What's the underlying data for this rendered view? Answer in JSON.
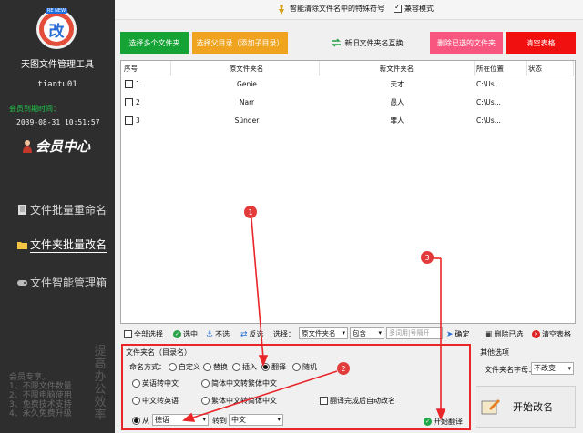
{
  "sidebar": {
    "logo_badge": "RE NEW",
    "logo_char": "改",
    "app_title": "天图文件管理工具",
    "user": "tiantu01",
    "expire_label": "会员到期时间：",
    "expire_date": "2039-08-31 10:51:57",
    "member_center": "会员中心",
    "nav": [
      "文件批量重命名",
      "文件夹批量改名",
      "文件智能管理箱"
    ],
    "vip_lines": [
      "会员专享。",
      "1、不限文件数量",
      "2、不限电脑使用",
      "3、免费技术支持",
      "4、永久免费升级"
    ],
    "ad": "提高办公效率"
  },
  "topbar": {
    "special_chars": "智能清除文件名中的特殊符号",
    "compat_mode": "兼容模式"
  },
  "toolbar": {
    "add_multi": "选择多个文件夹",
    "add_sub": "选择父目录（添加子目录）",
    "swap": "新旧文件夹名互换",
    "delete_selected": "删除已选的文件夹",
    "clear_table": "清空表格"
  },
  "table": {
    "headers": [
      "序号",
      "原文件夹名",
      "新文件夹名",
      "所在位置",
      "状态"
    ],
    "rows": [
      {
        "no": "1",
        "orig": "Genie",
        "new": "天才",
        "loc": "C:\\Us...",
        "status": ""
      },
      {
        "no": "2",
        "orig": "Narr",
        "new": "愚人",
        "loc": "C:\\Us...",
        "status": ""
      },
      {
        "no": "3",
        "orig": "Sünder",
        "new": "罪人",
        "loc": "C:\\Us...",
        "status": ""
      }
    ]
  },
  "selbar": {
    "select_all": "全部选择",
    "check": "选中",
    "uncheck": "不选",
    "invert": "反选",
    "select_label": "选择：",
    "field": "原文件夹名",
    "match": "包含",
    "placeholder": "多词用|号隔开",
    "confirm": "确定",
    "delete_sel": "删除已选",
    "clear": "清空表格"
  },
  "panel": {
    "title": "文件夹名（目录名）",
    "mode_label": "命名方式：",
    "modes": [
      "自定义",
      "替换",
      "插入",
      "翻译",
      "随机"
    ],
    "options": [
      "英语转中文",
      "简体中文转繁体中文",
      "中文转英语",
      "繁体中文转简体中文"
    ],
    "auto_rename": "翻译完成后自动改名",
    "from_label": "从",
    "from_lang": "德语",
    "to_label": "转到",
    "to_lang": "中文",
    "start_translate": "开始翻译"
  },
  "other": {
    "title": "其他选项",
    "case_label": "文件夹名字母：",
    "case_value": "不改变"
  },
  "start_button": "开始改名",
  "annotations": [
    "1",
    "2",
    "3"
  ]
}
